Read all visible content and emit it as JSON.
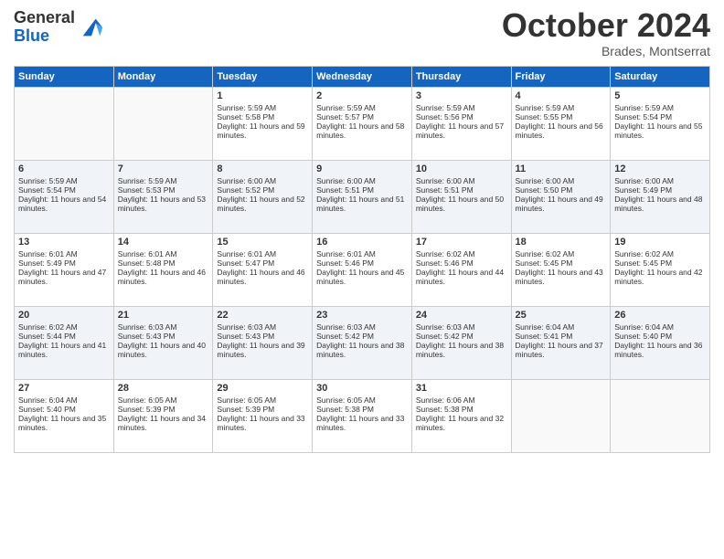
{
  "logo": {
    "line1": "General",
    "line2": "Blue"
  },
  "title": "October 2024",
  "location": "Brades, Montserrat",
  "days_header": [
    "Sunday",
    "Monday",
    "Tuesday",
    "Wednesday",
    "Thursday",
    "Friday",
    "Saturday"
  ],
  "weeks": [
    [
      {
        "day": "",
        "info": ""
      },
      {
        "day": "",
        "info": ""
      },
      {
        "day": "1",
        "info": "Sunrise: 5:59 AM\nSunset: 5:58 PM\nDaylight: 11 hours and 59 minutes."
      },
      {
        "day": "2",
        "info": "Sunrise: 5:59 AM\nSunset: 5:57 PM\nDaylight: 11 hours and 58 minutes."
      },
      {
        "day": "3",
        "info": "Sunrise: 5:59 AM\nSunset: 5:56 PM\nDaylight: 11 hours and 57 minutes."
      },
      {
        "day": "4",
        "info": "Sunrise: 5:59 AM\nSunset: 5:55 PM\nDaylight: 11 hours and 56 minutes."
      },
      {
        "day": "5",
        "info": "Sunrise: 5:59 AM\nSunset: 5:54 PM\nDaylight: 11 hours and 55 minutes."
      }
    ],
    [
      {
        "day": "6",
        "info": "Sunrise: 5:59 AM\nSunset: 5:54 PM\nDaylight: 11 hours and 54 minutes."
      },
      {
        "day": "7",
        "info": "Sunrise: 5:59 AM\nSunset: 5:53 PM\nDaylight: 11 hours and 53 minutes."
      },
      {
        "day": "8",
        "info": "Sunrise: 6:00 AM\nSunset: 5:52 PM\nDaylight: 11 hours and 52 minutes."
      },
      {
        "day": "9",
        "info": "Sunrise: 6:00 AM\nSunset: 5:51 PM\nDaylight: 11 hours and 51 minutes."
      },
      {
        "day": "10",
        "info": "Sunrise: 6:00 AM\nSunset: 5:51 PM\nDaylight: 11 hours and 50 minutes."
      },
      {
        "day": "11",
        "info": "Sunrise: 6:00 AM\nSunset: 5:50 PM\nDaylight: 11 hours and 49 minutes."
      },
      {
        "day": "12",
        "info": "Sunrise: 6:00 AM\nSunset: 5:49 PM\nDaylight: 11 hours and 48 minutes."
      }
    ],
    [
      {
        "day": "13",
        "info": "Sunrise: 6:01 AM\nSunset: 5:49 PM\nDaylight: 11 hours and 47 minutes."
      },
      {
        "day": "14",
        "info": "Sunrise: 6:01 AM\nSunset: 5:48 PM\nDaylight: 11 hours and 46 minutes."
      },
      {
        "day": "15",
        "info": "Sunrise: 6:01 AM\nSunset: 5:47 PM\nDaylight: 11 hours and 46 minutes."
      },
      {
        "day": "16",
        "info": "Sunrise: 6:01 AM\nSunset: 5:46 PM\nDaylight: 11 hours and 45 minutes."
      },
      {
        "day": "17",
        "info": "Sunrise: 6:02 AM\nSunset: 5:46 PM\nDaylight: 11 hours and 44 minutes."
      },
      {
        "day": "18",
        "info": "Sunrise: 6:02 AM\nSunset: 5:45 PM\nDaylight: 11 hours and 43 minutes."
      },
      {
        "day": "19",
        "info": "Sunrise: 6:02 AM\nSunset: 5:45 PM\nDaylight: 11 hours and 42 minutes."
      }
    ],
    [
      {
        "day": "20",
        "info": "Sunrise: 6:02 AM\nSunset: 5:44 PM\nDaylight: 11 hours and 41 minutes."
      },
      {
        "day": "21",
        "info": "Sunrise: 6:03 AM\nSunset: 5:43 PM\nDaylight: 11 hours and 40 minutes."
      },
      {
        "day": "22",
        "info": "Sunrise: 6:03 AM\nSunset: 5:43 PM\nDaylight: 11 hours and 39 minutes."
      },
      {
        "day": "23",
        "info": "Sunrise: 6:03 AM\nSunset: 5:42 PM\nDaylight: 11 hours and 38 minutes."
      },
      {
        "day": "24",
        "info": "Sunrise: 6:03 AM\nSunset: 5:42 PM\nDaylight: 11 hours and 38 minutes."
      },
      {
        "day": "25",
        "info": "Sunrise: 6:04 AM\nSunset: 5:41 PM\nDaylight: 11 hours and 37 minutes."
      },
      {
        "day": "26",
        "info": "Sunrise: 6:04 AM\nSunset: 5:40 PM\nDaylight: 11 hours and 36 minutes."
      }
    ],
    [
      {
        "day": "27",
        "info": "Sunrise: 6:04 AM\nSunset: 5:40 PM\nDaylight: 11 hours and 35 minutes."
      },
      {
        "day": "28",
        "info": "Sunrise: 6:05 AM\nSunset: 5:39 PM\nDaylight: 11 hours and 34 minutes."
      },
      {
        "day": "29",
        "info": "Sunrise: 6:05 AM\nSunset: 5:39 PM\nDaylight: 11 hours and 33 minutes."
      },
      {
        "day": "30",
        "info": "Sunrise: 6:05 AM\nSunset: 5:38 PM\nDaylight: 11 hours and 33 minutes."
      },
      {
        "day": "31",
        "info": "Sunrise: 6:06 AM\nSunset: 5:38 PM\nDaylight: 11 hours and 32 minutes."
      },
      {
        "day": "",
        "info": ""
      },
      {
        "day": "",
        "info": ""
      }
    ]
  ]
}
